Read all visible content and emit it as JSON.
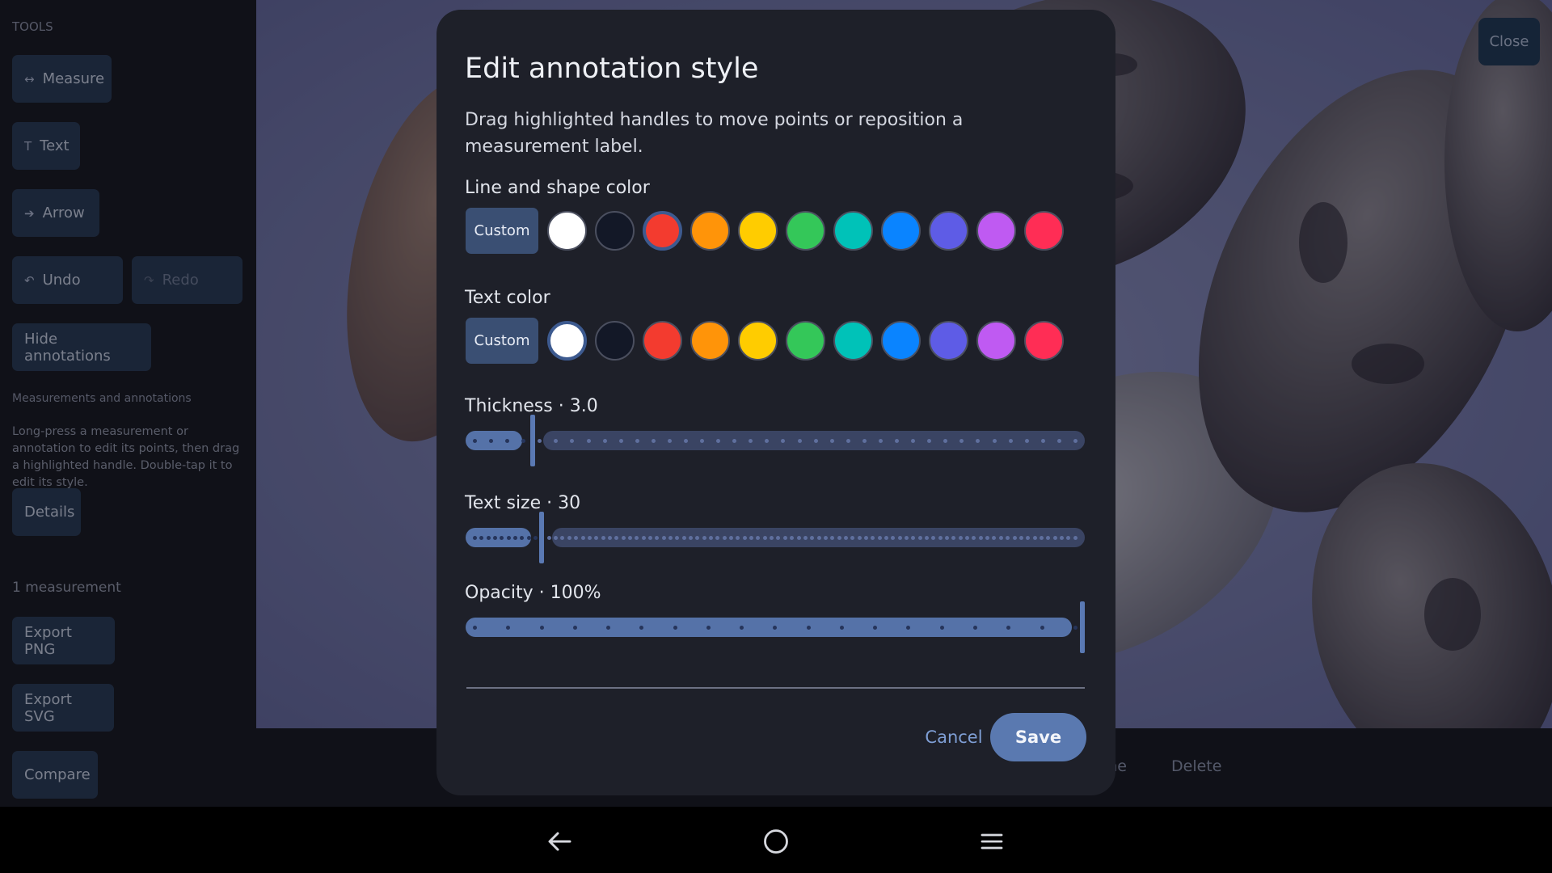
{
  "sidebar": {
    "heading": "TOOLS",
    "measure_label": "Measure",
    "measure_icon": "↔",
    "text_label": "Text",
    "text_icon": "T",
    "arrow_label": "Arrow",
    "arrow_icon": "➔",
    "undo_label": "Undo",
    "undo_icon": "↶",
    "redo_label": "Redo",
    "redo_icon": "↷",
    "hide_label": "Hide annotations",
    "section_title": "Measurements and annotations",
    "help_text": "Long-press a measurement or annotation to edit its points, then drag a highlighted handle. Double-tap it to edit its style.",
    "details_label": "Details",
    "count_text": "1 measurement",
    "export_png_label": "Export PNG",
    "export_svg_label": "Export SVG",
    "compare_label": "Compare"
  },
  "topbar": {
    "close_label": "Close"
  },
  "bottombar": {
    "done_label": "Done",
    "delete_label": "Delete"
  },
  "dialog": {
    "title": "Edit annotation style",
    "description": "Drag highlighted handles to move points or reposition a measurement label.",
    "line_color": {
      "label": "Line and shape color",
      "custom_label": "Custom",
      "swatches": [
        "#ffffff",
        "#131827",
        "#f33b2f",
        "#ff9409",
        "#ffcc00",
        "#34c759",
        "#00c2b8",
        "#0a84ff",
        "#5e5ce6",
        "#bf5af2",
        "#ff2d55"
      ],
      "selected_index": 2
    },
    "text_color": {
      "label": "Text color",
      "custom_label": "Custom",
      "swatches": [
        "#ffffff",
        "#131827",
        "#f33b2f",
        "#ff9409",
        "#ffcc00",
        "#34c759",
        "#00c2b8",
        "#0a84ff",
        "#5e5ce6",
        "#bf5af2",
        "#ff2d55"
      ],
      "selected_index": 0
    },
    "thickness": {
      "label": "Thickness · 3.0",
      "fraction": 0.105,
      "dot_count": 38
    },
    "text_size": {
      "label": "Text size · 30",
      "fraction": 0.12,
      "dot_count": 90
    },
    "opacity": {
      "label": "Opacity · 100%",
      "fraction": 1.0,
      "dot_count": 19
    },
    "cancel_label": "Cancel",
    "save_label": "Save"
  },
  "colors": {
    "accent": "#5a79b0",
    "dialog_bg": "#1e2029",
    "sidebar_bg": "#1a1c27"
  }
}
